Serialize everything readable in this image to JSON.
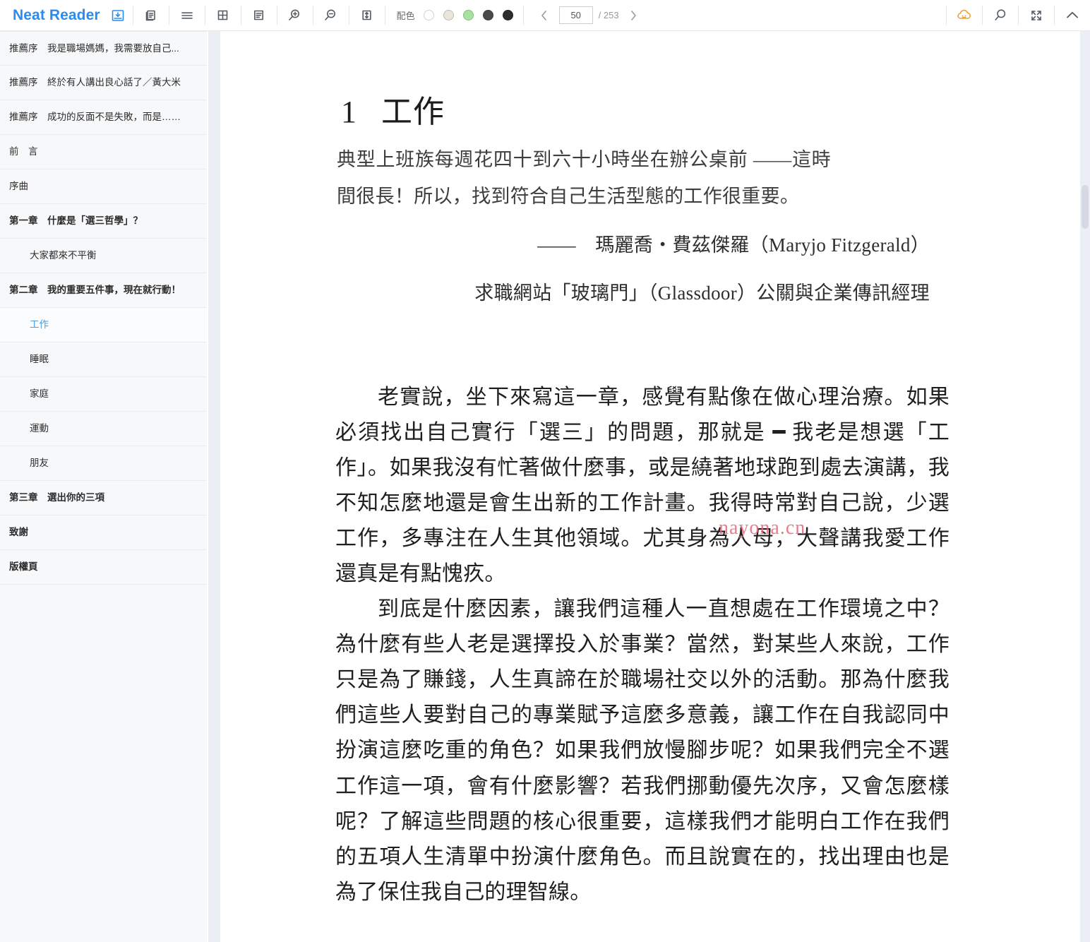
{
  "app": {
    "brand": "Neat Reader",
    "save_icon": "save-download-icon"
  },
  "toolbar": {
    "buttons": [
      {
        "name": "copy-pages-icon",
        "label": ""
      },
      {
        "name": "menu-lines-icon",
        "label": ""
      },
      {
        "name": "grid-layout-icon",
        "label": ""
      },
      {
        "name": "text-layout-icon",
        "label": ""
      },
      {
        "name": "zoom-in-icon",
        "label": ""
      },
      {
        "name": "zoom-out-icon",
        "label": ""
      },
      {
        "name": "line-height-icon",
        "label": ""
      }
    ],
    "color_scheme": {
      "label": "配色",
      "swatches": [
        {
          "name": "scheme-white",
          "color": "#ffffff"
        },
        {
          "name": "scheme-sepia",
          "color": "#ece6da"
        },
        {
          "name": "scheme-green",
          "color": "#a8e2a0"
        },
        {
          "name": "scheme-dark-gray",
          "color": "#4a4a4a"
        },
        {
          "name": "scheme-black",
          "color": "#2e2e2e"
        }
      ]
    },
    "pager": {
      "prev": "‹",
      "next": "›",
      "current_page": "50",
      "page_placeholder": "50",
      "total_label": "/ 253"
    },
    "right_buttons": [
      {
        "name": "cloud-sync-icon",
        "color": "#e8a33d"
      },
      {
        "name": "search-icon",
        "color": "#555c63"
      },
      {
        "name": "fullscreen-icon",
        "color": "#555c63"
      },
      {
        "name": "collapse-up-icon",
        "color": "#555c63"
      }
    ]
  },
  "sidebar": {
    "items": [
      {
        "label": "推薦序　我是職場媽媽，我需要放自己...",
        "level": 1,
        "bold": false,
        "active": false
      },
      {
        "label": "推薦序　終於有人講出良心話了／黃大米",
        "level": 1,
        "bold": false,
        "active": false
      },
      {
        "label": "推薦序　成功的反面不是失敗，而是……",
        "level": 1,
        "bold": false,
        "active": false
      },
      {
        "label": "前　言",
        "level": 1,
        "bold": false,
        "active": false
      },
      {
        "label": "序曲",
        "level": 1,
        "bold": false,
        "active": false
      },
      {
        "label": "第一章　什麼是「選三哲學」？",
        "level": 1,
        "bold": true,
        "active": false
      },
      {
        "label": "大家都來不平衡",
        "level": 2,
        "bold": false,
        "active": false
      },
      {
        "label": "第二章　我的重要五件事，現在就行動！",
        "level": 1,
        "bold": true,
        "active": false
      },
      {
        "label": "工作",
        "level": 2,
        "bold": false,
        "active": true
      },
      {
        "label": "睡眠",
        "level": 2,
        "bold": false,
        "active": false
      },
      {
        "label": "家庭",
        "level": 2,
        "bold": false,
        "active": false
      },
      {
        "label": "運動",
        "level": 2,
        "bold": false,
        "active": false
      },
      {
        "label": "朋友",
        "level": 2,
        "bold": false,
        "active": false
      },
      {
        "label": "第三章　選出你的三項",
        "level": 1,
        "bold": true,
        "active": false
      },
      {
        "label": "致謝",
        "level": 1,
        "bold": true,
        "active": false
      },
      {
        "label": "版權頁",
        "level": 1,
        "bold": true,
        "active": false
      }
    ]
  },
  "book": {
    "chapter_number": "1",
    "chapter_title": "工作",
    "epigraph": "典型上班族每週花四十到六十小時坐在辦公桌前 ——這時間很長！所以，找到符合自己生活型態的工作很重要。",
    "attribution_line1": "——　瑪麗喬・費茲傑羅（Maryjo Fitzgerald）",
    "attribution_line2": "求職網站「玻璃門」（Glassdoor）公關與企業傳訊經理",
    "paragraphs": [
      "老實說，坐下來寫這一章，感覺有點像在做心理治療。如果必須找出自己實行「選三」的問題，那就是 ━ 我老是想選「工作」。如果我沒有忙著做什麼事，或是繞著地球跑到處去演講，我不知怎麼地還是會生出新的工作計畫。我得時常對自己說，少選工作，多專注在人生其他領域。尤其身為人母，大聲講我愛工作還真是有點愧疚。",
      "到底是什麼因素，讓我們這種人一直想處在工作環境之中？為什麼有些人老是選擇投入於事業？當然，對某些人來說，工作只是為了賺錢，人生真諦在於職場社交以外的活動。那為什麼我們這些人要對自己的專業賦予這麼多意義，讓工作在自我認同中扮演這麼吃重的角色？如果我們放慢腳步呢？如果我們完全不選工作這一項，會有什麼影響？若我們挪動優先次序，又會怎麼樣呢？了解這些問題的核心很重要，這樣我們才能明白工作在我們的五項人生清單中扮演什麼角色。而且說實在的，找出理由也是為了保住我自己的理智線。"
    ],
    "watermark": "nayona.cn"
  }
}
